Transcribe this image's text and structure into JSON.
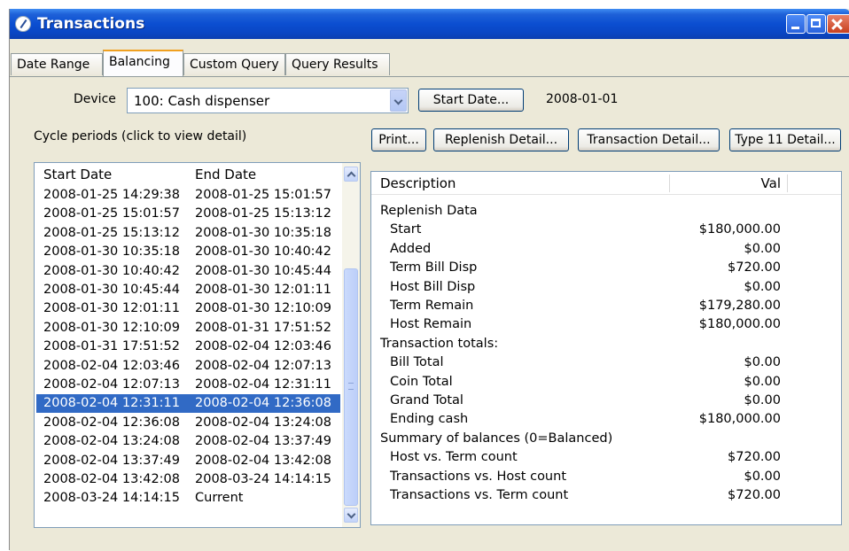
{
  "window": {
    "title": "Transactions"
  },
  "tabs": [
    {
      "label": "Date Range"
    },
    {
      "label": "Balancing"
    },
    {
      "label": "Custom Query"
    },
    {
      "label": "Query Results"
    }
  ],
  "device": {
    "label": "Device",
    "selected": "100: Cash dispenser"
  },
  "start_date": {
    "button_label": "Start Date...",
    "value": "2008-01-01"
  },
  "cycle": {
    "caption": "Cycle periods (click to view detail)"
  },
  "actions": {
    "print": "Print...",
    "replenish": "Replenish Detail...",
    "transaction": "Transaction Detail...",
    "type11": "Type 11 Detail..."
  },
  "cycle_table": {
    "columns": [
      "Start Date",
      "End Date"
    ],
    "selected_index": 11,
    "rows": [
      [
        "2008-01-25 14:29:38",
        "2008-01-25 15:01:57"
      ],
      [
        "2008-01-25 15:01:57",
        "2008-01-25 15:13:12"
      ],
      [
        "2008-01-25 15:13:12",
        "2008-01-30 10:35:18"
      ],
      [
        "2008-01-30 10:35:18",
        "2008-01-30 10:40:42"
      ],
      [
        "2008-01-30 10:40:42",
        "2008-01-30 10:45:44"
      ],
      [
        "2008-01-30 10:45:44",
        "2008-01-30 12:01:11"
      ],
      [
        "2008-01-30 12:01:11",
        "2008-01-30 12:10:09"
      ],
      [
        "2008-01-30 12:10:09",
        "2008-01-31 17:51:52"
      ],
      [
        "2008-01-31 17:51:52",
        "2008-02-04 12:03:46"
      ],
      [
        "2008-02-04 12:03:46",
        "2008-02-04 12:07:13"
      ],
      [
        "2008-02-04 12:07:13",
        "2008-02-04 12:31:11"
      ],
      [
        "2008-02-04 12:31:11",
        "2008-02-04 12:36:08"
      ],
      [
        "2008-02-04 12:36:08",
        "2008-02-04 13:24:08"
      ],
      [
        "2008-02-04 13:24:08",
        "2008-02-04 13:37:49"
      ],
      [
        "2008-02-04 13:37:49",
        "2008-02-04 13:42:08"
      ],
      [
        "2008-02-04 13:42:08",
        "2008-03-24 14:14:15"
      ],
      [
        "2008-03-24 14:14:15",
        "Current"
      ]
    ]
  },
  "detail_table": {
    "columns": [
      "Description",
      "Val"
    ],
    "rows": [
      {
        "desc": "Replenish Data",
        "val": "",
        "indent": 0
      },
      {
        "desc": "Start",
        "val": "$180,000.00",
        "indent": 1
      },
      {
        "desc": "Added",
        "val": "$0.00",
        "indent": 1
      },
      {
        "desc": "Term Bill Disp",
        "val": "$720.00",
        "indent": 1
      },
      {
        "desc": "Host Bill Disp",
        "val": "$0.00",
        "indent": 1
      },
      {
        "desc": "Term Remain",
        "val": "$179,280.00",
        "indent": 1
      },
      {
        "desc": "Host Remain",
        "val": "$180,000.00",
        "indent": 1
      },
      {
        "desc": "Transaction totals:",
        "val": "",
        "indent": 0
      },
      {
        "desc": "Bill Total",
        "val": "$0.00",
        "indent": 1
      },
      {
        "desc": "Coin Total",
        "val": "$0.00",
        "indent": 1
      },
      {
        "desc": "Grand Total",
        "val": "$0.00",
        "indent": 1
      },
      {
        "desc": "Ending cash",
        "val": "$180,000.00",
        "indent": 1
      },
      {
        "desc": "Summary of balances (0=Balanced)",
        "val": "",
        "indent": 0
      },
      {
        "desc": "Host vs. Term count",
        "val": "$720.00",
        "indent": 1
      },
      {
        "desc": "Transactions vs. Host count",
        "val": "$0.00",
        "indent": 1
      },
      {
        "desc": "Transactions vs. Term count",
        "val": "$720.00",
        "indent": 1
      }
    ]
  }
}
